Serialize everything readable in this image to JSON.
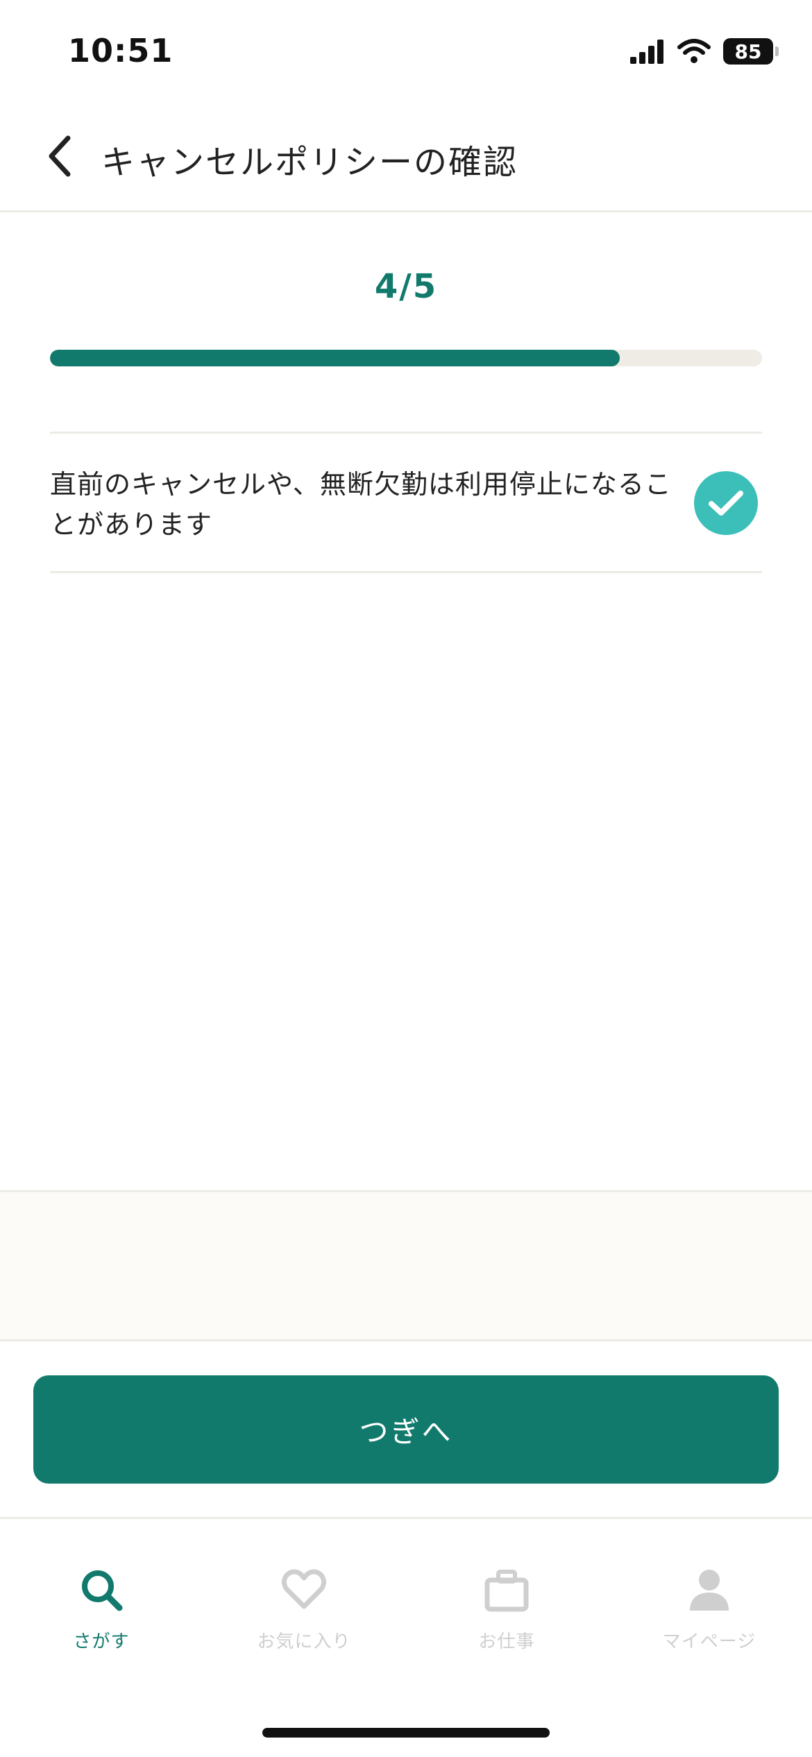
{
  "status": {
    "time": "10:51",
    "battery": "85"
  },
  "header": {
    "title": "キャンセルポリシーの確認"
  },
  "progress": {
    "label": "4/5",
    "value": 0.8
  },
  "policy_item": {
    "text": "直前のキャンセルや、無断欠勤は利用停止になることがあります",
    "checked": true
  },
  "next_button": {
    "label": "つぎへ"
  },
  "tabs": [
    {
      "label": "さがす",
      "icon": "search-icon",
      "active": true
    },
    {
      "label": "お気に入り",
      "icon": "heart-icon",
      "active": false
    },
    {
      "label": "お仕事",
      "icon": "briefcase-icon",
      "active": false
    },
    {
      "label": "マイページ",
      "icon": "person-icon",
      "active": false
    }
  ],
  "colors": {
    "brand": "#117a6d",
    "check": "#3cbfb8",
    "inactive": "#cfcfcf"
  }
}
